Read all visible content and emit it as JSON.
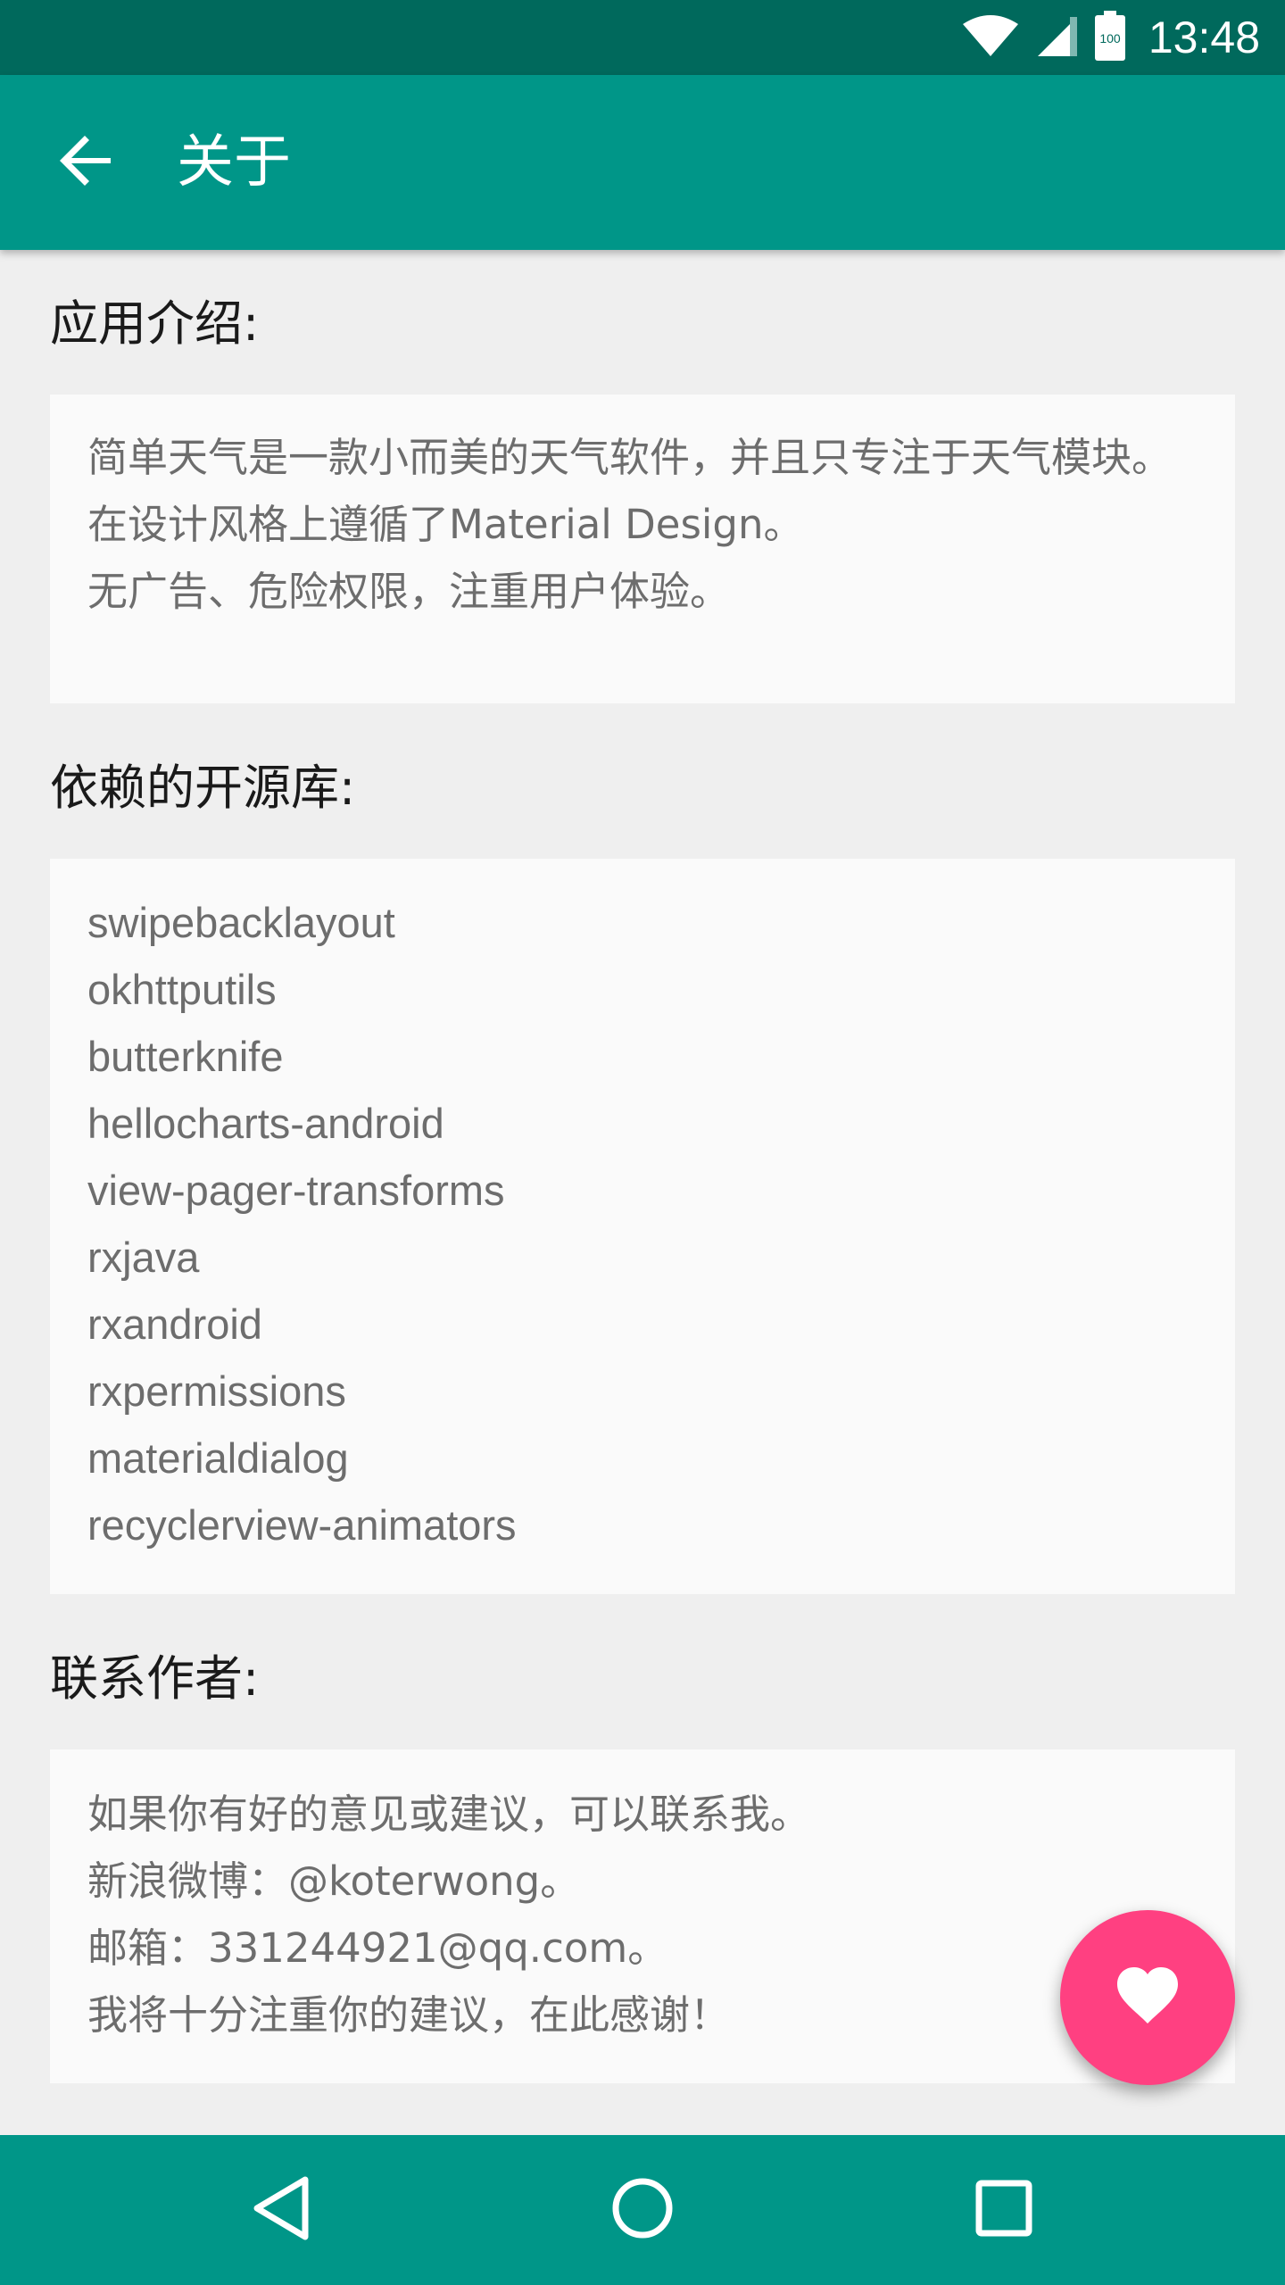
{
  "status_bar": {
    "time": "13:48",
    "battery_level_text": "100",
    "icons": [
      "wifi-icon",
      "cell-signal-icon",
      "battery-icon"
    ]
  },
  "toolbar": {
    "title": "关于",
    "back_icon": "arrow-back-icon"
  },
  "sections": {
    "intro": {
      "title": "应用介绍:",
      "lines": [
        "简单天气是一款小而美的天气软件，并且只专注于天气模块。",
        "在设计风格上遵循了Material Design。",
        "无广告、危险权限，注重用户体验。"
      ]
    },
    "libraries": {
      "title": "依赖的开源库:",
      "items": [
        "swipebacklayout",
        "okhttputils",
        "butterknife",
        "hellocharts-android",
        "view-pager-transforms",
        "rxjava",
        "rxandroid",
        "rxpermissions",
        "materialdialog",
        "recyclerview-animators"
      ]
    },
    "contact": {
      "title": "联系作者:",
      "lines": [
        "如果你有好的意见或建议，可以联系我。",
        "新浪微博：@koterwong。",
        "邮箱：331244921@qq.com。",
        "我将十分注重你的建议，在此感谢！"
      ]
    }
  },
  "fab": {
    "icon": "heart-icon",
    "color": "#ff4081"
  },
  "nav_bar": {
    "icons": [
      "nav-back-icon",
      "nav-home-icon",
      "nav-recents-icon"
    ]
  },
  "colors": {
    "status_bar": "#00695c",
    "primary": "#009688",
    "accent": "#ff4081",
    "background": "#efefef",
    "card": "#fafafa"
  }
}
